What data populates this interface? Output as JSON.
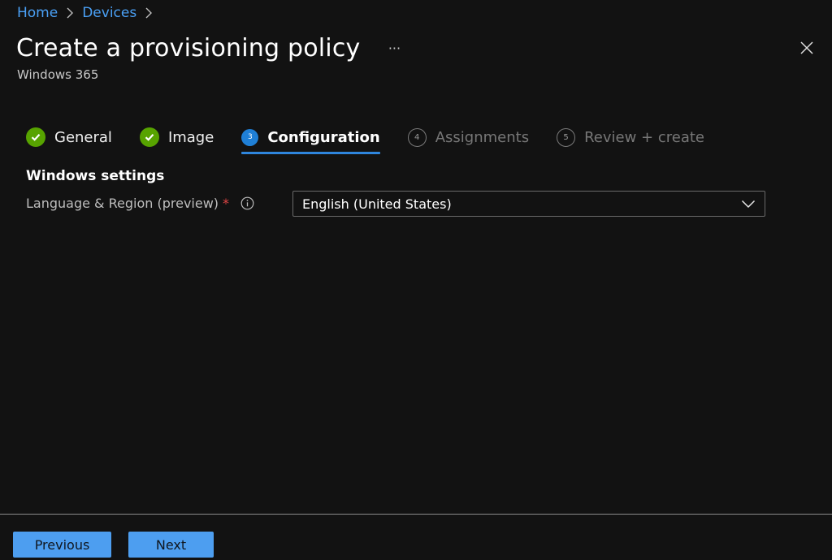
{
  "breadcrumb": {
    "items": [
      {
        "label": "Home"
      },
      {
        "label": "Devices"
      }
    ]
  },
  "header": {
    "title": "Create a provisioning policy",
    "subtitle": "Windows 365",
    "more_label": "···"
  },
  "wizard": {
    "steps": [
      {
        "label": "General",
        "state": "done",
        "number": "1"
      },
      {
        "label": "Image",
        "state": "done",
        "number": "2"
      },
      {
        "label": "Configuration",
        "state": "current",
        "number": "3"
      },
      {
        "label": "Assignments",
        "state": "pending",
        "number": "4"
      },
      {
        "label": "Review + create",
        "state": "pending",
        "number": "5"
      }
    ]
  },
  "configuration": {
    "section_title": "Windows settings",
    "language_region": {
      "label": "Language & Region (preview)",
      "required_mark": "*",
      "value": "English (United States)"
    }
  },
  "footer": {
    "previous_label": "Previous",
    "next_label": "Next"
  },
  "colors": {
    "accent": "#4d9ef0",
    "link": "#4aa0f5",
    "success": "#57a300",
    "current_step": "#1f7fd6",
    "required": "#e04545",
    "background": "#121212"
  }
}
